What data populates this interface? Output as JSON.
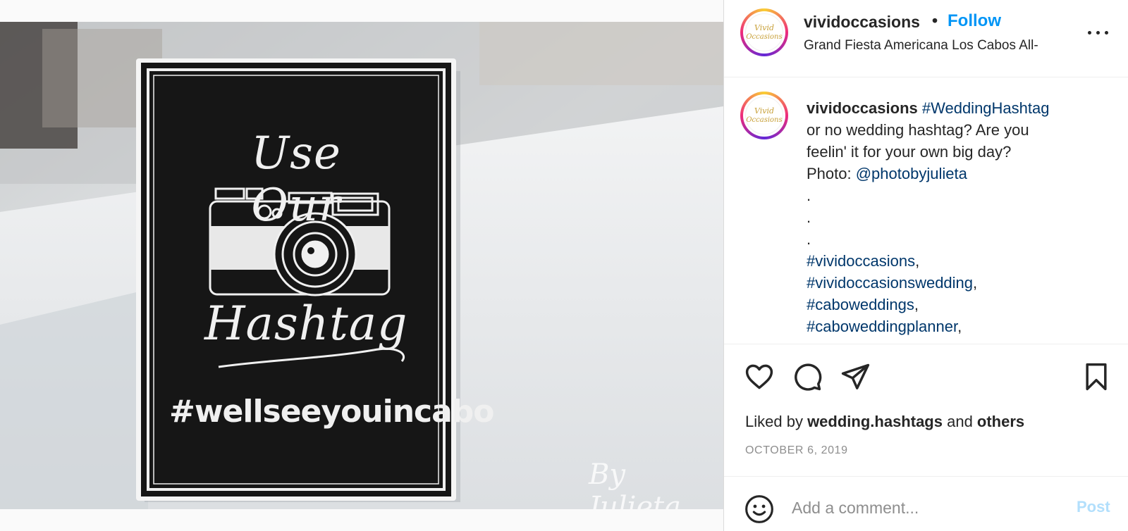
{
  "post": {
    "username": "vividoccasions",
    "separator": "•",
    "follow_label": "Follow",
    "location": "Grand Fiesta Americana Los Cabos All-",
    "more_icon": "more-horizontal-icon",
    "avatar_text": "Vivid Occasions"
  },
  "image": {
    "sign_title_line1": "Use Our",
    "sign_title_line2": "Hashtag",
    "sign_hashtag": "#wellseeyouincabo",
    "watermark": "By Julieta"
  },
  "caption": {
    "username": "vividoccasions",
    "hashtag_main": "#WeddingHashtag",
    "text_line1": "or no wedding hashtag? Are you",
    "text_line2": "feelin' it for your own big day?",
    "photo_prefix": "Photo: ",
    "photo_mention": "@photobyjulieta",
    "dot1": ".",
    "dot2": ".",
    "dot3": ".",
    "tags": [
      "#vividoccasions",
      "#vividoccasionswedding",
      "#caboweddings",
      "#caboweddingplanner"
    ]
  },
  "actions": {
    "like_icon": "heart-icon",
    "comment_icon": "comment-icon",
    "share_icon": "paper-plane-icon",
    "save_icon": "bookmark-icon"
  },
  "likes": {
    "prefix": "Liked by ",
    "user": "wedding.hashtags",
    "middle": " and ",
    "others": "others"
  },
  "date": "OCTOBER 6, 2019",
  "comment": {
    "placeholder": "Add a comment...",
    "post_label": "Post",
    "emoji_icon": "smiley-icon"
  },
  "colors": {
    "follow": "#0095f6",
    "link": "#00376b",
    "post_disabled": "#b2dffc",
    "muted": "#8e8e8e"
  }
}
